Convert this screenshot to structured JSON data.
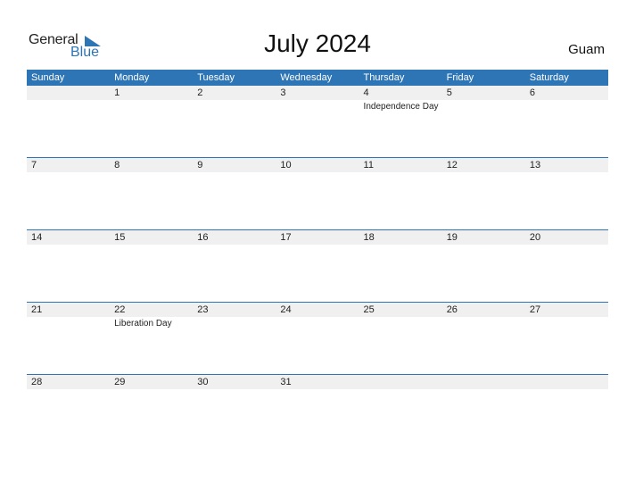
{
  "logo": {
    "general": "General",
    "blue": "Blue",
    "accent": "#2e75b6"
  },
  "title": "July 2024",
  "country": "Guam",
  "weekdays": [
    "Sunday",
    "Monday",
    "Tuesday",
    "Wednesday",
    "Thursday",
    "Friday",
    "Saturday"
  ],
  "weeks": [
    [
      {
        "d": ""
      },
      {
        "d": "1"
      },
      {
        "d": "2"
      },
      {
        "d": "3"
      },
      {
        "d": "4",
        "holiday": "Independence Day"
      },
      {
        "d": "5"
      },
      {
        "d": "6"
      }
    ],
    [
      {
        "d": "7"
      },
      {
        "d": "8"
      },
      {
        "d": "9"
      },
      {
        "d": "10"
      },
      {
        "d": "11"
      },
      {
        "d": "12"
      },
      {
        "d": "13"
      }
    ],
    [
      {
        "d": "14"
      },
      {
        "d": "15"
      },
      {
        "d": "16"
      },
      {
        "d": "17"
      },
      {
        "d": "18"
      },
      {
        "d": "19"
      },
      {
        "d": "20"
      }
    ],
    [
      {
        "d": "21"
      },
      {
        "d": "22",
        "holiday": "Liberation Day"
      },
      {
        "d": "23"
      },
      {
        "d": "24"
      },
      {
        "d": "25"
      },
      {
        "d": "26"
      },
      {
        "d": "27"
      }
    ],
    [
      {
        "d": "28"
      },
      {
        "d": "29"
      },
      {
        "d": "30"
      },
      {
        "d": "31"
      },
      {
        "d": ""
      },
      {
        "d": ""
      },
      {
        "d": ""
      }
    ]
  ]
}
